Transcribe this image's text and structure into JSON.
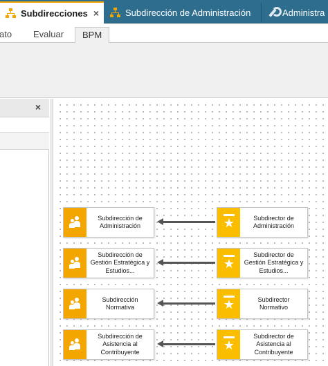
{
  "doc_tabs": [
    {
      "label": "Subdirecciones",
      "close": "×",
      "icon": "org-chart-icon"
    },
    {
      "label": "Subdirección de Administración",
      "icon": "org-chart-icon"
    },
    {
      "label": "Administra",
      "icon": "wrench-icon"
    }
  ],
  "ribbon_tabs": [
    {
      "label": "ato"
    },
    {
      "label": "Evaluar"
    },
    {
      "label": "BPM"
    }
  ],
  "left_panel": {
    "close": "×"
  },
  "diagram": {
    "rows": [
      {
        "unit": "Subdirección de Administración",
        "role": "Subdirector de Administración"
      },
      {
        "unit": "Subdirección de Gestión Estratégica y Estudios...",
        "role": "Subdirector de Gestión Estratégica y Estudios..."
      },
      {
        "unit": "Subdirección Normativa",
        "role": "Subdirector Normativo"
      },
      {
        "unit": "Subdirección de Asistencia al Contribuyente",
        "role": "Subdirector de Asistencia al Contribuyente"
      }
    ],
    "unit_icon": "group-icon",
    "role_icon": "role-star-icon",
    "colors": {
      "unit_badge": "#f3a500",
      "role_badge": "#fbbd00",
      "tab_bar": "#2f6d8e"
    }
  }
}
